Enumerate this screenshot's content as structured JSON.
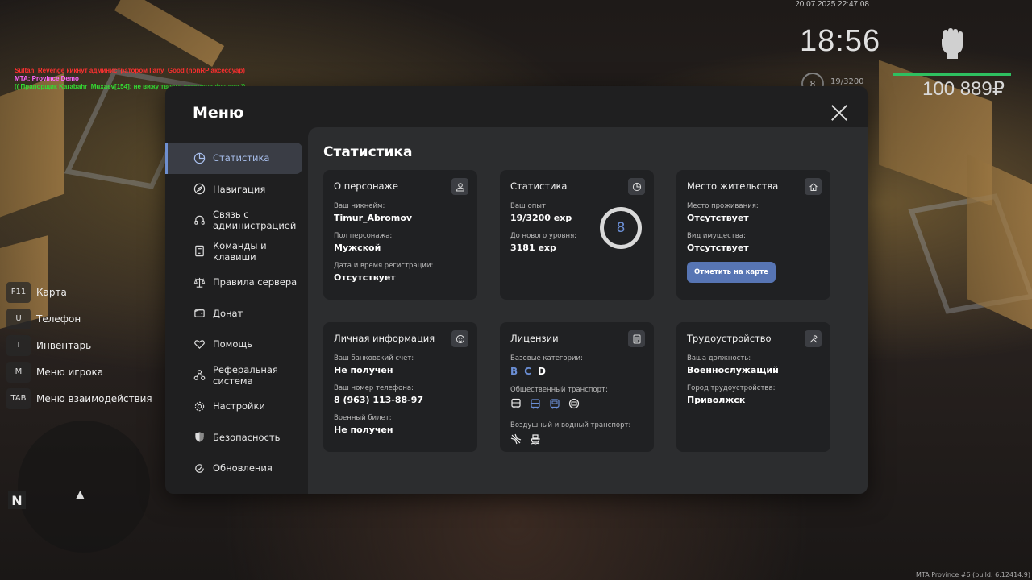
{
  "hud": {
    "datetime": "20.07.2025 22:47:08",
    "clock": "18:56",
    "level": "8",
    "exp": "19/3200",
    "money": "100 889₽"
  },
  "chat": {
    "lines": [
      {
        "text": "Sultan_Revenge кикнут администратором Ilany_Good (nonRP аксессуар)",
        "color": "#ff3030"
      },
      {
        "text": "MTA: Province Demo",
        "color": "#ff66ff"
      },
      {
        "text": "(( Прапорщик Karabahr_Muxaev[154]: не вижу твоего экзаменa фаневи ))",
        "color": "#33dd33"
      }
    ]
  },
  "hotkeys": [
    {
      "key": "F11",
      "label": "Карта"
    },
    {
      "key": "U",
      "label": "Телефон"
    },
    {
      "key": "I",
      "label": "Инвентарь"
    },
    {
      "key": "M",
      "label": "Меню игрока"
    },
    {
      "key": "TAB",
      "label": "Меню взаимодействия"
    }
  ],
  "minimap": {
    "north": "N"
  },
  "build": "MTA Province #6 (build: 6.12414.9)",
  "menu": {
    "title": "Меню",
    "sidebar": [
      {
        "label": "Статистика",
        "icon": "chart-pie-icon",
        "active": true
      },
      {
        "label": "Навигация",
        "icon": "compass-icon"
      },
      {
        "label": "Связь с администрацией",
        "icon": "headset-icon"
      },
      {
        "label": "Команды и клавиши",
        "icon": "document-icon"
      },
      {
        "label": "Правила сервера",
        "icon": "scales-icon"
      },
      {
        "label": "Донат",
        "icon": "wallet-icon"
      },
      {
        "label": "Помощь",
        "icon": "heart-hands-icon"
      },
      {
        "label": "Реферальная система",
        "icon": "people-network-icon"
      },
      {
        "label": "Настройки",
        "icon": "gear-icon"
      },
      {
        "label": "Безопасность",
        "icon": "shield-icon"
      },
      {
        "label": "Обновления",
        "icon": "refresh-check-icon"
      }
    ],
    "content_title": "Статистика",
    "cards": {
      "character": {
        "title": "О персонаже",
        "nickname_label": "Ваш никнейм:",
        "nickname": "Timur_Abromov",
        "gender_label": "Пол персонажа:",
        "gender": "Мужской",
        "reg_label": "Дата и время регистрации:",
        "reg": "Отсутствует"
      },
      "stats": {
        "title": "Статистика",
        "exp_label": "Ваш опыт:",
        "exp": "19/3200 exp",
        "next_label": "До нового уровня:",
        "next": "3181 exp",
        "level": "8"
      },
      "residence": {
        "title": "Место жительства",
        "place_label": "Место проживания:",
        "place": "Отсутствует",
        "property_label": "Вид имущества:",
        "property": "Отсутствует",
        "button": "Отметить на карте"
      },
      "personal": {
        "title": "Личная информация",
        "bank_label": "Ваш банковский счет:",
        "bank": "Не получен",
        "phone_label": "Ваш номер телефона:",
        "phone": "8 (963) 113-88-97",
        "military_label": "Военный билет:",
        "military": "Не получен"
      },
      "licenses": {
        "title": "Лицензии",
        "base_label": "Базовые категории:",
        "categories": [
          {
            "label": "B",
            "owned": true
          },
          {
            "label": "C",
            "owned": true
          },
          {
            "label": "D",
            "owned": false
          }
        ],
        "public_label": "Общественный транспорт:",
        "public_icons": [
          "bus-icon",
          "trolleybus-icon",
          "tram-icon",
          "taxi-icon"
        ],
        "air_label": "Воздушный и водный транспорт:",
        "air_icons": [
          "airplane-icon",
          "boat-icon"
        ]
      },
      "job": {
        "title": "Трудоустройство",
        "position_label": "Ваша должность:",
        "position": "Военнослужащий",
        "city_label": "Город трудоустройства:",
        "city": "Приволжск"
      }
    }
  },
  "colors": {
    "accent": "#6b8fd6",
    "button": "#5775b4",
    "window_bg": "#1f1f20",
    "panel_bg": "#2c2d2f",
    "card_bg": "#202123",
    "money_bar": "#2ec060"
  }
}
